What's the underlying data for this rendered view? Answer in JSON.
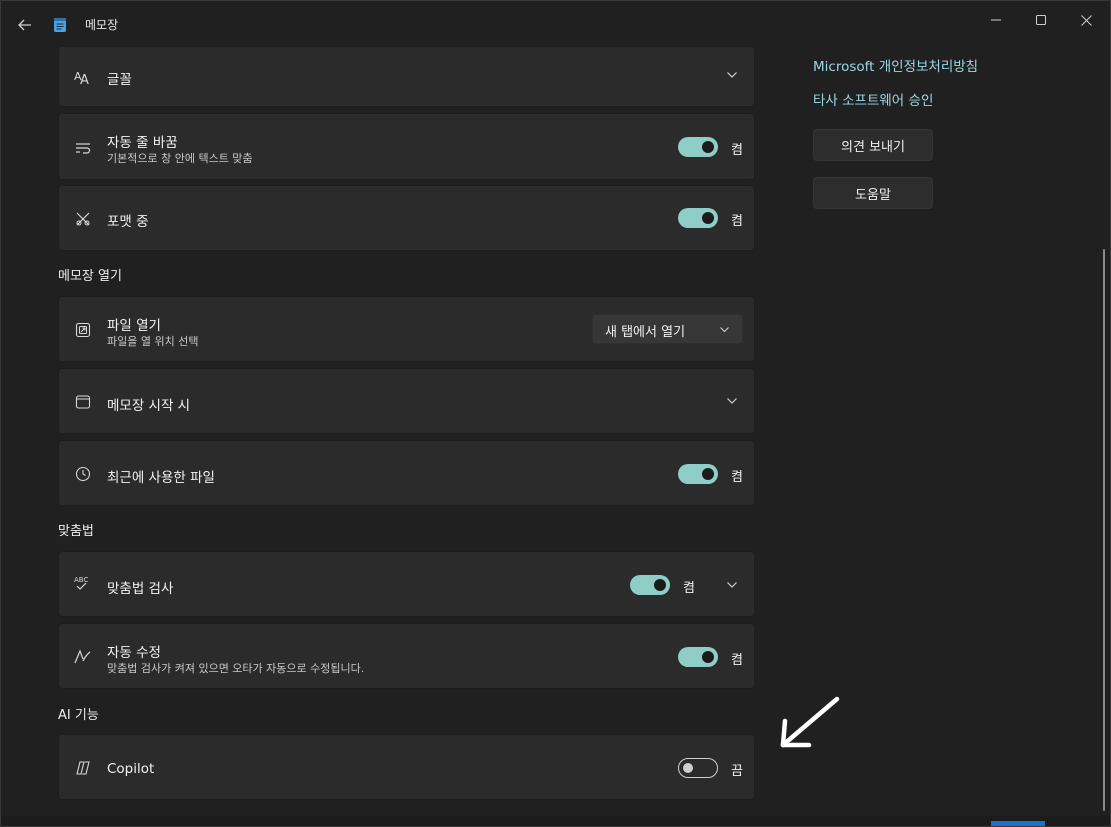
{
  "titlebar": {
    "title": "메모장",
    "icons": [
      "back-arrow-icon",
      "notepad-icon",
      "minimize-icon",
      "maximize-icon",
      "close-icon"
    ]
  },
  "cards": {
    "font": {
      "title": "글꼴",
      "icon": "font-icon"
    },
    "word_wrap": {
      "title": "자동 줄 바꿈",
      "desc": "기본적으로 창 안에 텍스트 맞춤",
      "state": "켬",
      "on": true,
      "icon": "wrap-icon"
    },
    "formatting": {
      "title": "포맷 중",
      "state": "켬",
      "on": true,
      "icon": "format-icon"
    },
    "open_file": {
      "title": "파일 열기",
      "desc": "파일을 열 위치 선택",
      "dropdown": "새 탭에서 열기",
      "icon": "open-file-icon"
    },
    "startup": {
      "title": "메모장 시작 시",
      "icon": "window-icon"
    },
    "recent": {
      "title": "최근에 사용한 파일",
      "state": "켬",
      "on": true,
      "icon": "clock-icon"
    },
    "spellcheck": {
      "title": "맞춤법 검사",
      "state": "켬",
      "on": true,
      "icon": "spellcheck-icon"
    },
    "autocorrect": {
      "title": "자동 수정",
      "desc": "맞춤법 검사가 켜져 있으면 오타가 자동으로 수정됩니다.",
      "state": "켬",
      "on": true,
      "icon": "autocorrect-icon"
    },
    "copilot": {
      "title": "Copilot",
      "state": "끔",
      "on": false,
      "icon": "copilot-icon"
    }
  },
  "sections": {
    "open": "메모장 열기",
    "spelling": "맞춤법",
    "ai": "AI 기능"
  },
  "sidebar": {
    "privacy_link": "Microsoft 개인정보처리방침",
    "thirdparty_link": "타사 소프트웨어 승인",
    "feedback_button": "의견 보내기",
    "help_button": "도움말"
  },
  "colors": {
    "accent_toggle": "#8fcdc7",
    "link": "#9ad7e3",
    "card_bg": "#2b2b2b",
    "window_bg": "#202020"
  }
}
